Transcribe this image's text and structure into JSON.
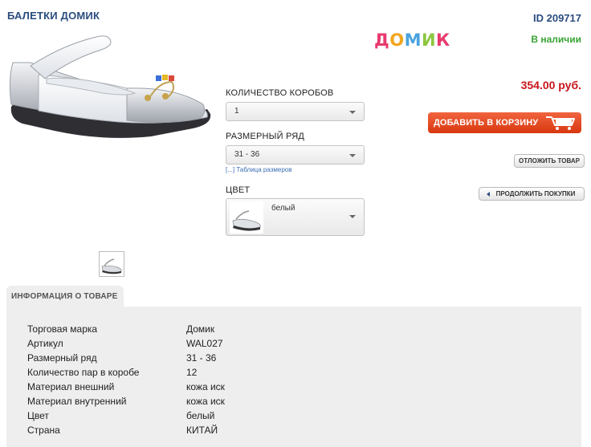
{
  "product": {
    "title": "БАЛЕТКИ ДОМИК",
    "id": "ID 209717",
    "brand_logo": [
      "Д",
      "О",
      "М",
      "И",
      "К"
    ],
    "brand_colors": [
      "#e83a6e",
      "#f2a51c",
      "#4aa3df",
      "#8cc63f",
      "#e83a6e"
    ],
    "stock": "В наличии",
    "price": "354.00 руб."
  },
  "options": {
    "boxes_label": "КОЛИЧЕСТВО КОРОБОВ",
    "boxes_value": "1",
    "size_label": "РАЗМЕРНЫЙ РЯД",
    "size_value": "31 - 36",
    "size_table_link": "[...] Таблица размеров",
    "color_label": "ЦВЕТ",
    "color_value": "белый"
  },
  "actions": {
    "add_to_cart": "ДОБАВИТЬ В КОРЗИНУ",
    "defer": "ОТЛОЖИТЬ ТОВАР",
    "continue": "ПРОДОЛЖИТЬ ПОКУПКИ"
  },
  "info": {
    "tab_label": "ИНФОРМАЦИЯ О ТОВАРЕ",
    "rows": [
      {
        "name": "Торговая марка",
        "value": "Домик"
      },
      {
        "name": "Артикул",
        "value": "WAL027"
      },
      {
        "name": "Размерный ряд",
        "value": "31 - 36"
      },
      {
        "name": "Количество пар в коробе",
        "value": "12"
      },
      {
        "name": "Материал внешний",
        "value": "кожа иск"
      },
      {
        "name": "Материал внутренний",
        "value": "кожа иск"
      },
      {
        "name": "Цвет",
        "value": "белый"
      },
      {
        "name": "Страна",
        "value": "КИТАЙ"
      }
    ]
  }
}
